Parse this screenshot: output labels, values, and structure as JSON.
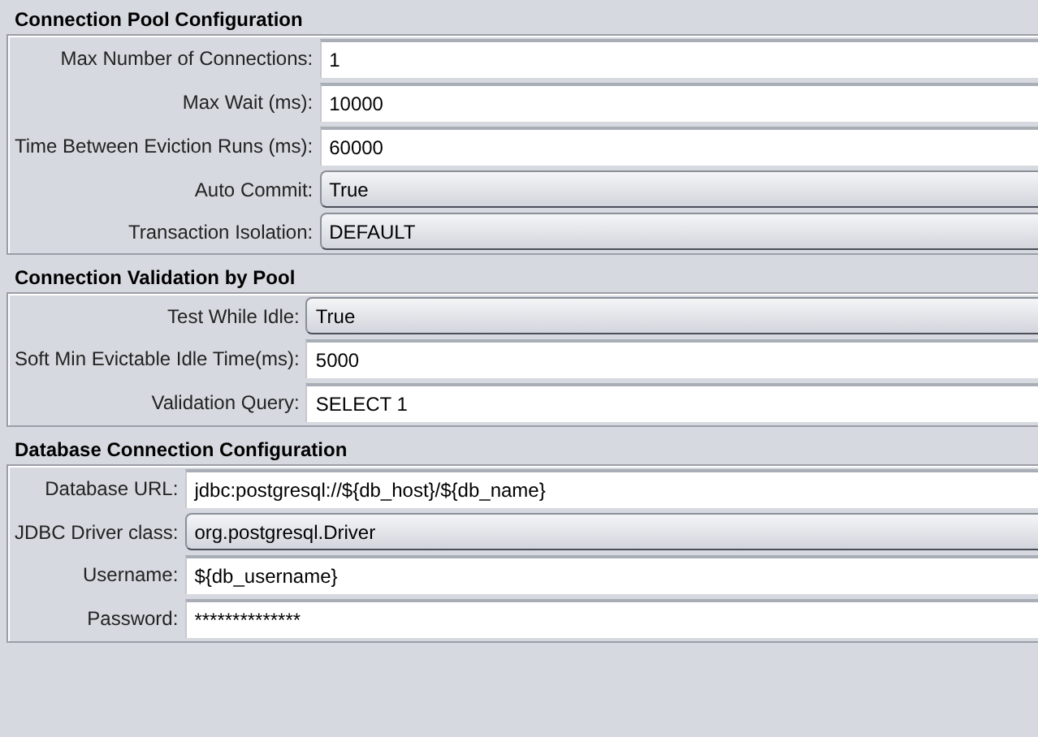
{
  "sections": [
    {
      "title": "Connection Pool Configuration",
      "fields": [
        {
          "label": "Max Number of Connections:",
          "kind": "text",
          "value": "1"
        },
        {
          "label": "Max Wait (ms):",
          "kind": "text",
          "value": "10000"
        },
        {
          "label": "Time Between Eviction Runs (ms):",
          "kind": "text",
          "value": "60000"
        },
        {
          "label": "Auto Commit:",
          "kind": "combo",
          "value": "True"
        },
        {
          "label": "Transaction Isolation:",
          "kind": "combo",
          "value": "DEFAULT"
        }
      ]
    },
    {
      "title": "Connection Validation by Pool",
      "fields": [
        {
          "label": "Test While Idle:",
          "kind": "combo",
          "value": "True"
        },
        {
          "label": "Soft Min Evictable Idle Time(ms):",
          "kind": "text",
          "value": "5000"
        },
        {
          "label": "Validation Query:",
          "kind": "text",
          "value": "SELECT 1"
        }
      ]
    },
    {
      "title": "Database Connection Configuration",
      "fields": [
        {
          "label": "Database URL:",
          "kind": "text",
          "value": "jdbc:postgresql://${db_host}/${db_name}"
        },
        {
          "label": "JDBC Driver class:",
          "kind": "combo",
          "value": "org.postgresql.Driver"
        },
        {
          "label": "Username:",
          "kind": "text",
          "value": "${db_username}"
        },
        {
          "label": "Password:",
          "kind": "password",
          "value": "**************"
        }
      ]
    }
  ]
}
